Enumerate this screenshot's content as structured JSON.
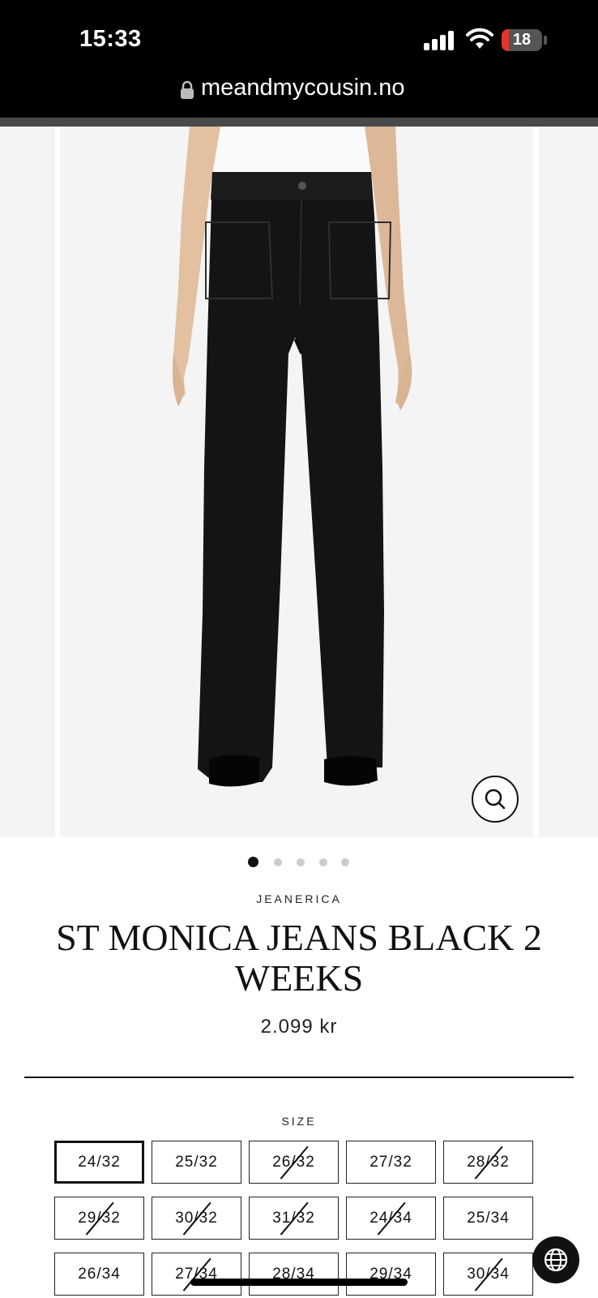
{
  "status_bar": {
    "time": "15:33",
    "battery_level": "18",
    "battery_fraction": 0.18,
    "battery_color": "#e5342c",
    "icons": [
      "signal-icon",
      "wifi-icon",
      "battery-icon"
    ]
  },
  "browser": {
    "url": "meandmycousin.no",
    "lock_icon": "lock-icon"
  },
  "gallery": {
    "slide_count": 5,
    "active_index": 0,
    "zoom_icon": "magnifier-icon"
  },
  "product": {
    "brand": "JEANERICA",
    "title": "ST MONICA JEANS BLACK 2 WEEKS",
    "price": "2.099 kr"
  },
  "size_selector": {
    "label": "SIZE",
    "sizes": [
      {
        "label": "24/32",
        "available": true,
        "selected": true
      },
      {
        "label": "25/32",
        "available": true,
        "selected": false
      },
      {
        "label": "26/32",
        "available": false,
        "selected": false
      },
      {
        "label": "27/32",
        "available": true,
        "selected": false
      },
      {
        "label": "28/32",
        "available": false,
        "selected": false
      },
      {
        "label": "29/32",
        "available": false,
        "selected": false
      },
      {
        "label": "30/32",
        "available": false,
        "selected": false
      },
      {
        "label": "31/32",
        "available": false,
        "selected": false
      },
      {
        "label": "24/34",
        "available": false,
        "selected": false
      },
      {
        "label": "25/34",
        "available": true,
        "selected": false
      },
      {
        "label": "26/34",
        "available": true,
        "selected": false
      },
      {
        "label": "27/34",
        "available": false,
        "selected": false
      },
      {
        "label": "28/34",
        "available": true,
        "selected": false
      },
      {
        "label": "29/34",
        "available": true,
        "selected": false
      },
      {
        "label": "30/34",
        "available": false,
        "selected": false
      }
    ]
  },
  "floating": {
    "globe_icon": "globe-icon"
  }
}
